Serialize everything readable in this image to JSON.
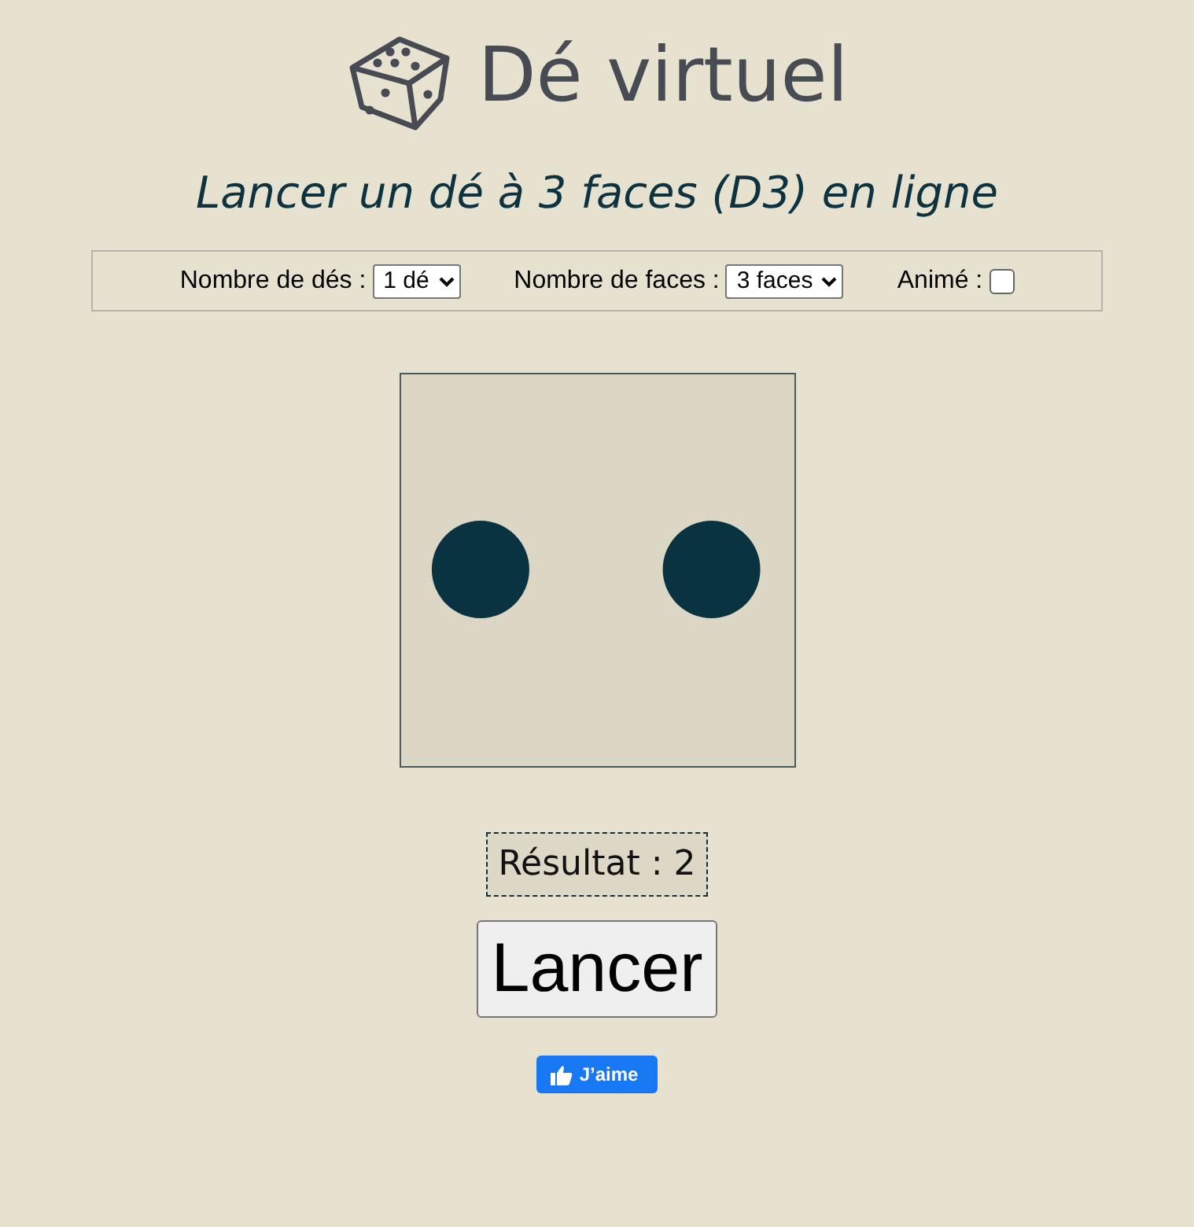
{
  "title": "Dé virtuel",
  "subtitle": "Lancer un dé à 3 faces (D3) en ligne",
  "controls": [
    {
      "kind": "select",
      "label": "Nombre de dés :",
      "value": "1 dé"
    },
    {
      "kind": "select",
      "label": "Nombre de faces :",
      "value": "3 faces"
    },
    {
      "kind": "checkbox",
      "label": "Animé :",
      "checked": false
    }
  ],
  "die": {
    "kind": "two"
  },
  "result": "Résultat : 2",
  "roll_button": "Lancer",
  "like_button": "J’aime"
}
